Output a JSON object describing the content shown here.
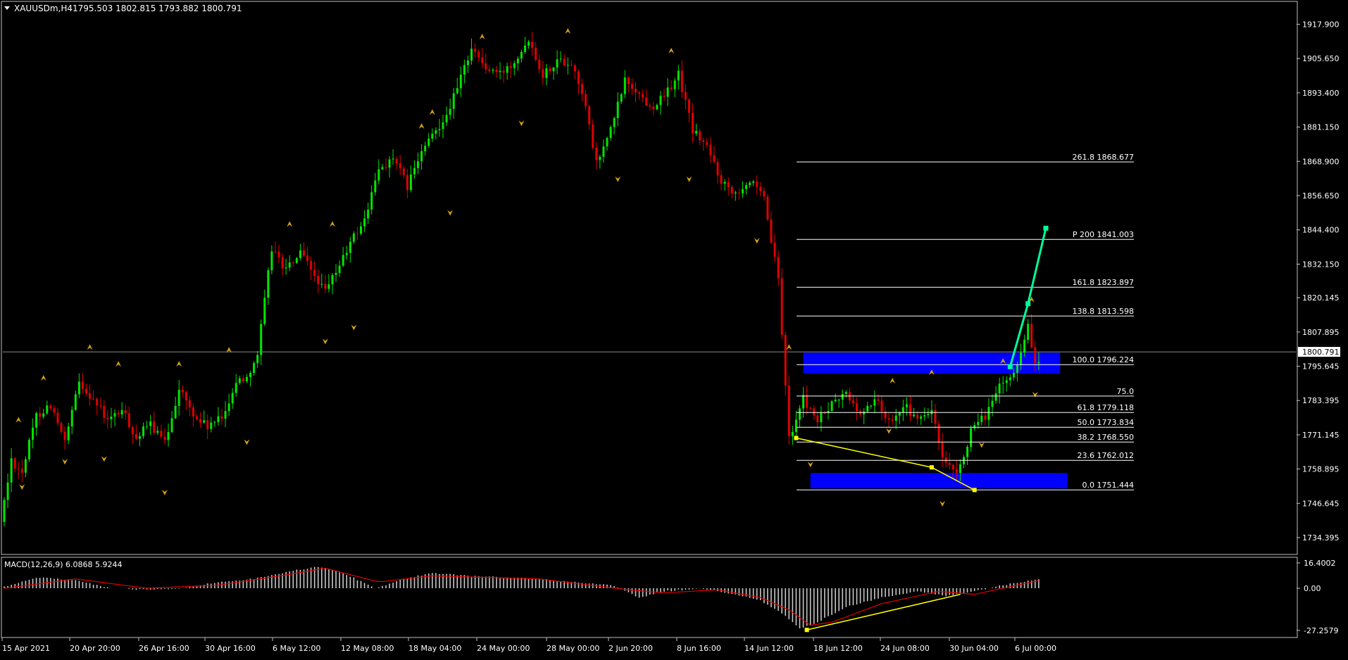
{
  "window": {
    "symbol_label": "XAUUSDm,H4",
    "ohlc_readout": "1795.503 1802.815 1793.882 1800.791",
    "menu_icon": "triangle-down-icon"
  },
  "colors": {
    "background": "#000000",
    "frame": "#c0c0c0",
    "bull": "#00e600",
    "bear": "#e00000",
    "fractal": "#d4a017",
    "zone": "#0000ff",
    "trend": "#ffff00",
    "projection": "#00ff99",
    "macd_hist": "#c8c8c8",
    "macd_signal": "#e00000"
  },
  "chart_data": [
    {
      "type": "candlestick",
      "title": "XAUUSDm,H4",
      "x_tick_labels": [
        "15 Apr 2021",
        "20 Apr 20:00",
        "26 Apr 16:00",
        "30 Apr 16:00",
        "6 May 12:00",
        "12 May 08:00",
        "18 May 04:00",
        "24 May 00:00",
        "28 May 00:00",
        "2 Jun 20:00",
        "8 Jun 16:00",
        "14 Jun 12:00",
        "18 Jun 12:00",
        "24 Jun 08:00",
        "30 Jun 04:00",
        "6 Jul 00:00"
      ],
      "y_tick_labels": [
        "1917.900",
        "1905.650",
        "1893.400",
        "1881.150",
        "1868.900",
        "1856.650",
        "1844.400",
        "1832.150",
        "1820.145",
        "1807.895",
        "1795.645",
        "1783.395",
        "1771.145",
        "1758.895",
        "1746.645",
        "1734.395"
      ],
      "ylim": [
        1727,
        1925
      ],
      "current_price_label": "1800.791",
      "current_price": 1800.791,
      "price_path": [
        [
          0,
          1740
        ],
        [
          3,
          1762
        ],
        [
          6,
          1758
        ],
        [
          10,
          1778
        ],
        [
          14,
          1782
        ],
        [
          18,
          1768
        ],
        [
          22,
          1790
        ],
        [
          26,
          1784
        ],
        [
          30,
          1776
        ],
        [
          34,
          1780
        ],
        [
          38,
          1770
        ],
        [
          42,
          1775
        ],
        [
          46,
          1768
        ],
        [
          50,
          1788
        ],
        [
          54,
          1778
        ],
        [
          58,
          1774
        ],
        [
          62,
          1777
        ],
        [
          66,
          1790
        ],
        [
          69,
          1792
        ],
        [
          72,
          1800
        ],
        [
          76,
          1838
        ],
        [
          80,
          1830
        ],
        [
          84,
          1836
        ],
        [
          88,
          1828
        ],
        [
          91,
          1822
        ],
        [
          95,
          1832
        ],
        [
          99,
          1842
        ],
        [
          102,
          1848
        ],
        [
          106,
          1866
        ],
        [
          110,
          1870
        ],
        [
          114,
          1860
        ],
        [
          118,
          1872
        ],
        [
          122,
          1880
        ],
        [
          125,
          1886
        ],
        [
          128,
          1895
        ],
        [
          132,
          1910
        ],
        [
          136,
          1902
        ],
        [
          140,
          1900
        ],
        [
          144,
          1905
        ],
        [
          148,
          1913
        ],
        [
          152,
          1900
        ],
        [
          156,
          1905
        ],
        [
          160,
          1904
        ],
        [
          163,
          1894
        ],
        [
          167,
          1868
        ],
        [
          171,
          1880
        ],
        [
          175,
          1898
        ],
        [
          179,
          1893
        ],
        [
          182,
          1888
        ],
        [
          186,
          1892
        ],
        [
          190,
          1900
        ],
        [
          194,
          1880
        ],
        [
          198,
          1874
        ],
        [
          202,
          1862
        ],
        [
          206,
          1858
        ],
        [
          210,
          1862
        ],
        [
          214,
          1855
        ],
        [
          218,
          1826
        ],
        [
          221,
          1770
        ],
        [
          225,
          1784
        ],
        [
          229,
          1776
        ],
        [
          233,
          1782
        ],
        [
          237,
          1786
        ],
        [
          241,
          1778
        ],
        [
          245,
          1784
        ],
        [
          249,
          1776
        ],
        [
          253,
          1782
        ],
        [
          257,
          1776
        ],
        [
          261,
          1780
        ],
        [
          264,
          1762
        ],
        [
          268,
          1756
        ],
        [
          272,
          1772
        ],
        [
          276,
          1778
        ],
        [
          280,
          1788
        ],
        [
          284,
          1793
        ],
        [
          288,
          1810
        ],
        [
          290,
          1797
        ]
      ],
      "fractal_highs": [
        [
          4,
          1775
        ],
        [
          11,
          1790
        ],
        [
          24,
          1801
        ],
        [
          32,
          1795
        ],
        [
          49,
          1795
        ],
        [
          63,
          1800
        ],
        [
          80,
          1845
        ],
        [
          92,
          1845
        ],
        [
          117,
          1880
        ],
        [
          120,
          1885
        ],
        [
          134,
          1912
        ],
        [
          158,
          1914
        ],
        [
          187,
          1907
        ],
        [
          220,
          1801
        ],
        [
          249,
          1789
        ],
        [
          260,
          1792
        ],
        [
          280,
          1796
        ],
        [
          288,
          1818
        ]
      ],
      "fractal_lows": [
        [
          5,
          1754
        ],
        [
          17,
          1763
        ],
        [
          28,
          1764
        ],
        [
          45,
          1752
        ],
        [
          68,
          1770
        ],
        [
          90,
          1806
        ],
        [
          98,
          1811
        ],
        [
          125,
          1852
        ],
        [
          145,
          1884
        ],
        [
          172,
          1864
        ],
        [
          192,
          1864
        ],
        [
          211,
          1842
        ],
        [
          226,
          1762
        ],
        [
          248,
          1774
        ],
        [
          263,
          1748
        ],
        [
          274,
          1769
        ],
        [
          289,
          1787
        ]
      ]
    },
    {
      "type": "histogram",
      "title": "MACD(12,26,9) 6.0868 5.9244",
      "y_tick_labels": [
        "16.4002",
        "0.00",
        "-27.2579"
      ],
      "ylim": [
        -27.2579,
        16.4002
      ],
      "macd_path": [
        [
          0,
          1
        ],
        [
          10,
          7
        ],
        [
          20,
          5
        ],
        [
          30,
          0
        ],
        [
          40,
          -1
        ],
        [
          50,
          0
        ],
        [
          60,
          4
        ],
        [
          70,
          6
        ],
        [
          80,
          11
        ],
        [
          88,
          14
        ],
        [
          95,
          10
        ],
        [
          104,
          0
        ],
        [
          112,
          6
        ],
        [
          120,
          10
        ],
        [
          130,
          8
        ],
        [
          140,
          7
        ],
        [
          150,
          6
        ],
        [
          160,
          4
        ],
        [
          170,
          2
        ],
        [
          178,
          -6
        ],
        [
          185,
          -2
        ],
        [
          195,
          0
        ],
        [
          205,
          -4
        ],
        [
          212,
          -8
        ],
        [
          218,
          -16
        ],
        [
          223,
          -26
        ],
        [
          228,
          -22
        ],
        [
          236,
          -12
        ],
        [
          246,
          -6
        ],
        [
          256,
          -2
        ],
        [
          264,
          -5
        ],
        [
          272,
          -2
        ],
        [
          280,
          2
        ],
        [
          290,
          6
        ]
      ],
      "signal_path": [
        [
          0,
          0
        ],
        [
          20,
          6
        ],
        [
          40,
          0
        ],
        [
          60,
          2
        ],
        [
          80,
          9
        ],
        [
          90,
          13
        ],
        [
          105,
          4
        ],
        [
          120,
          8
        ],
        [
          150,
          6
        ],
        [
          175,
          -1
        ],
        [
          185,
          -3
        ],
        [
          200,
          -1
        ],
        [
          212,
          -6
        ],
        [
          220,
          -14
        ],
        [
          226,
          -24
        ],
        [
          232,
          -22
        ],
        [
          246,
          -10
        ],
        [
          262,
          -2
        ],
        [
          272,
          -4
        ],
        [
          290,
          5
        ]
      ]
    }
  ],
  "fib_levels": [
    {
      "label": "261.8 1868.677",
      "price": 1868.677
    },
    {
      "label": "P 200 1841.003",
      "price": 1841.003
    },
    {
      "label": "161.8 1823.897",
      "price": 1823.897
    },
    {
      "label": "138.8 1813.598",
      "price": 1813.598
    },
    {
      "label": "100.0 1796.224",
      "price": 1796.224
    },
    {
      "label": "75.0",
      "price": 1785.0
    },
    {
      "label": "61.8 1779.118",
      "price": 1779.118
    },
    {
      "label": "50.0 1773.834",
      "price": 1773.834
    },
    {
      "label": "38.2 1768.550",
      "price": 1768.55
    },
    {
      "label": "23.6 1762.012",
      "price": 1762.012
    },
    {
      "label": "0.0 1751.444",
      "price": 1751.444
    }
  ],
  "zones": [
    {
      "name": "supply-zone",
      "bar_from": 224,
      "bar_to": 296,
      "price_top": 1800.5,
      "price_bottom": 1793.0
    },
    {
      "name": "demand-zone",
      "bar_from": 226,
      "bar_to": 298,
      "price_top": 1757.5,
      "price_bottom": 1752.0
    }
  ],
  "trendlines": [
    {
      "name": "price-trendline",
      "points": [
        [
          222,
          1770.0
        ],
        [
          260,
          1759.5
        ],
        [
          272,
          1751.4
        ]
      ]
    },
    {
      "name": "macd-trendline",
      "pane": "macd",
      "points": [
        [
          225,
          -27
        ],
        [
          268,
          -4
        ]
      ]
    }
  ],
  "projection": {
    "points": [
      [
        282,
        1795.5
      ],
      [
        287,
        1818.0
      ],
      [
        292,
        1845.0
      ]
    ]
  }
}
